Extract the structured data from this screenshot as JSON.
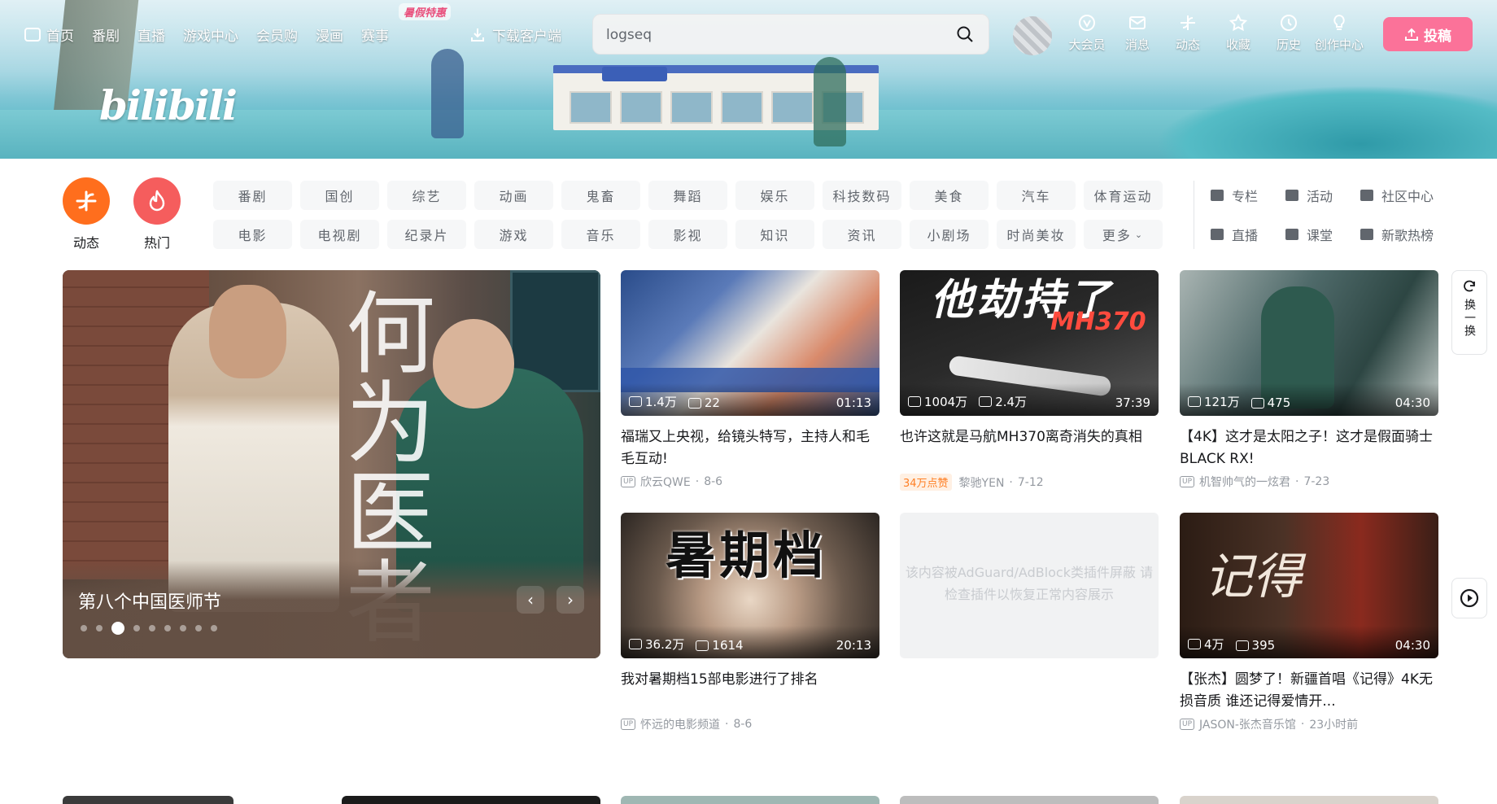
{
  "nav": {
    "items": [
      "首页",
      "番剧",
      "直播",
      "游戏中心",
      "会员购",
      "漫画",
      "赛事"
    ],
    "mini_badge": "暑假特惠",
    "download": "下载客户端"
  },
  "search": {
    "value": "logseq"
  },
  "right_nav": [
    "大会员",
    "消息",
    "动态",
    "收藏",
    "历史",
    "创作中心"
  ],
  "upload_label": "投稿",
  "brand": {
    "logo_text": "bilibili",
    "accent": "#fb7299",
    "orange": "#ff6e1d",
    "red": "#f55d5d"
  },
  "quick": [
    {
      "label": "动态",
      "icon": "dynamic-icon"
    },
    {
      "label": "热门",
      "icon": "flame-icon"
    }
  ],
  "channels": [
    "番剧",
    "国创",
    "综艺",
    "动画",
    "鬼畜",
    "舞蹈",
    "娱乐",
    "科技数码",
    "美食",
    "汽车",
    "体育运动",
    "电影",
    "电视剧",
    "纪录片",
    "游戏",
    "音乐",
    "影视",
    "知识",
    "资讯",
    "小剧场",
    "时尚美妆",
    "更多"
  ],
  "links": [
    "专栏",
    "活动",
    "社区中心",
    "直播",
    "课堂",
    "新歌热榜"
  ],
  "carousel": {
    "title": "第八个中国医师节",
    "art_text": "何为医者",
    "active_index": 2,
    "dot_count": 9
  },
  "videos": [
    {
      "title": "福瑞又上央视，给镜头特写，主持人和毛毛互动!",
      "author": "欣云QWE",
      "date": "8-6",
      "views": "1.4万",
      "danmaku": "22",
      "duration": "01:13",
      "hot": ""
    },
    {
      "title": "也许这就是马航MH370离奇消失的真相",
      "author": "黎驰YEN",
      "date": "7-12",
      "views": "1004万",
      "danmaku": "2.4万",
      "duration": "37:39",
      "hot": "34万点赞",
      "thumb_text": "他劫持了",
      "thumb_sub": "MH370"
    },
    {
      "title": "【4K】这才是太阳之子！这才是假面骑士BLACK RX!",
      "author": "机智帅气的一炫君",
      "date": "7-23",
      "views": "121万",
      "danmaku": "475",
      "duration": "04:30",
      "hot": ""
    },
    {
      "title": "我对暑期档15部电影进行了排名",
      "author": "怀远的电影频道",
      "date": "8-6",
      "views": "36.2万",
      "danmaku": "1614",
      "duration": "20:13",
      "hot": "",
      "thumb_text": "暑期档"
    },
    {
      "title": "【张杰】圆梦了！新疆首唱《记得》4K无损音质 谁还记得爱情开...",
      "author": "JASON-张杰音乐馆",
      "date": "23小时前",
      "views": "4万",
      "danmaku": "395",
      "duration": "04:30",
      "hot": "",
      "thumb_text": "记得"
    }
  ],
  "adblock_text": "该内容被AdGuard/AdBlock类插件屏蔽 请检查插件以恢复正常内容展示",
  "side": {
    "refresh_label": "换一换"
  }
}
